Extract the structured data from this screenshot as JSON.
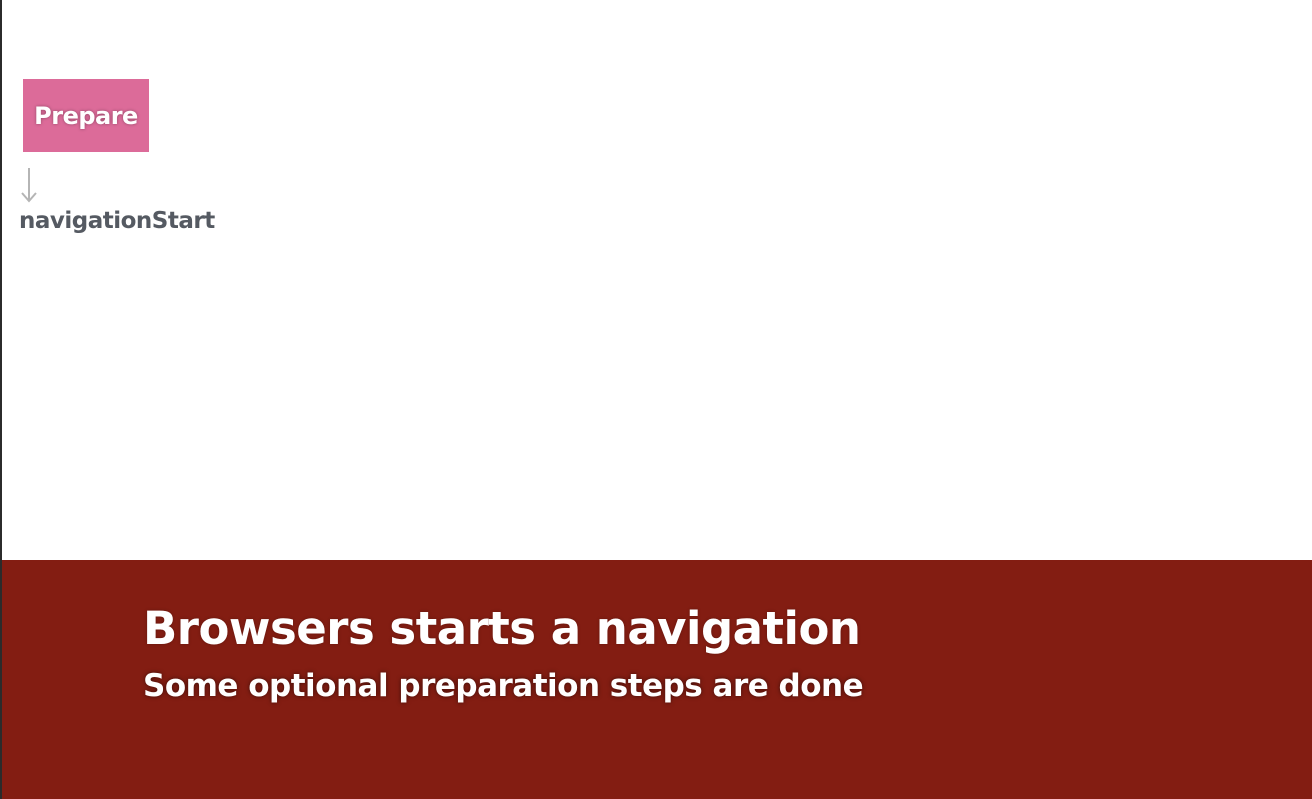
{
  "diagram": {
    "step_label": "Prepare",
    "step_color": "#dc6b99",
    "event_label": "navigationStart",
    "arrow_icon": "arrow-down-icon"
  },
  "caption": {
    "title": "Browsers starts a navigation",
    "subtitle": "Some optional preparation steps are done",
    "background_color": "#831d12"
  }
}
